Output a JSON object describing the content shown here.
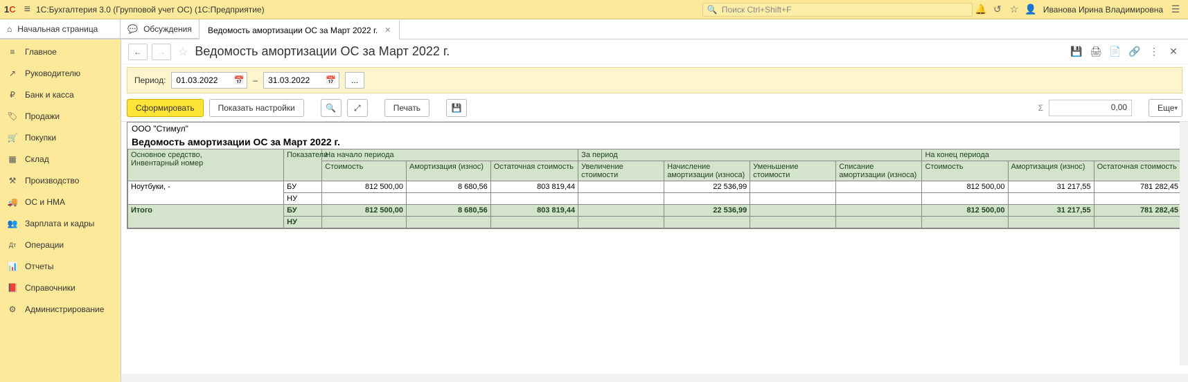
{
  "titlebar": {
    "logo_1": "1",
    "logo_c": "С",
    "app_title": "1С:Бухгалтерия 3.0 (Групповой учет ОС)  (1С:Предприятие)",
    "search_placeholder": "Поиск Ctrl+Shift+F",
    "user_name": "Иванова Ирина Владимировна"
  },
  "tabs": {
    "home": "Начальная страница",
    "discussions": "Обсуждения",
    "active": "Ведомость амортизации ОС за Март 2022 г."
  },
  "sidebar": {
    "items": [
      {
        "icon": "≡",
        "label": "Главное"
      },
      {
        "icon": "↗",
        "label": "Руководителю"
      },
      {
        "icon": "₽",
        "label": "Банк и касса"
      },
      {
        "icon": "🏷",
        "label": "Продажи"
      },
      {
        "icon": "🛒",
        "label": "Покупки"
      },
      {
        "icon": "▦",
        "label": "Склад"
      },
      {
        "icon": "⚒",
        "label": "Производство"
      },
      {
        "icon": "🚚",
        "label": "ОС и НМА"
      },
      {
        "icon": "👥",
        "label": "Зарплата и кадры"
      },
      {
        "icon": "Дт",
        "label": "Операции"
      },
      {
        "icon": "📊",
        "label": "Отчеты"
      },
      {
        "icon": "📕",
        "label": "Справочники"
      },
      {
        "icon": "⚙",
        "label": "Администрирование"
      }
    ]
  },
  "doc_header": {
    "title": "Ведомость амортизации ОС за Март 2022 г."
  },
  "period": {
    "label": "Период:",
    "from": "01.03.2022",
    "to": "31.03.2022",
    "dots": "..."
  },
  "toolbar": {
    "form": "Сформировать",
    "settings": "Показать настройки",
    "print": "Печать",
    "sum": "0,00",
    "more": "Еще"
  },
  "report": {
    "org": "ООО \"Стимул\"",
    "title": "Ведомость амортизации ОС за Март 2022 г.",
    "headers": {
      "asset": "Основное средство,\nИнвентарный номер",
      "ind": "Показатели",
      "start": "На начало периода",
      "period": "За период",
      "end": "На конец периода",
      "cost": "Стоимость",
      "depr": "Амортизация (износ)",
      "resid": "Остаточная стоимость",
      "inc_cost": "Увеличение стоимости",
      "acc_depr": "Начисление амортизации (износа)",
      "dec_cost": "Уменьшение стоимости",
      "wo_depr": "Списание амортизации (износа)"
    },
    "row": {
      "name": "Ноутбуки, -",
      "bu": "БУ",
      "nu": "НУ",
      "start_cost": "812 500,00",
      "start_depr": "8 680,56",
      "start_resid": "803 819,44",
      "acc_depr": "22 536,99",
      "end_cost": "812 500,00",
      "end_depr": "31 217,55",
      "end_resid": "781 282,45"
    },
    "total": {
      "label": "Итого",
      "bu": "БУ",
      "nu": "НУ",
      "start_cost": "812 500,00",
      "start_depr": "8 680,56",
      "start_resid": "803 819,44",
      "acc_depr": "22 536,99",
      "end_cost": "812 500,00",
      "end_depr": "31 217,55",
      "end_resid": "781 282,45"
    }
  }
}
